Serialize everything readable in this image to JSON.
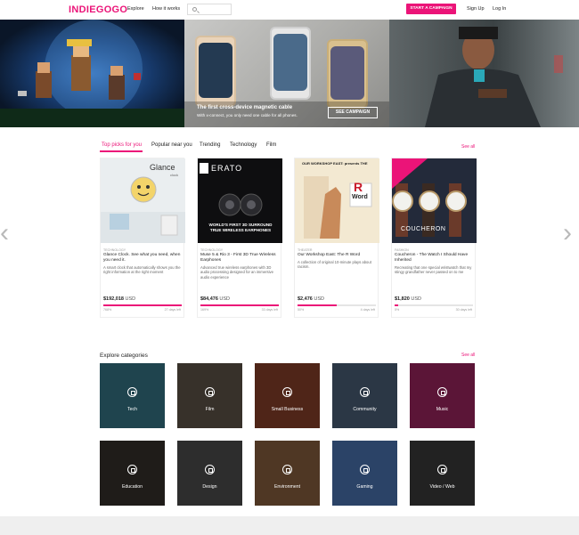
{
  "header": {
    "logo": "INDIEGOGO",
    "nav": [
      "Explore",
      "How it works"
    ],
    "cta": "START A CAMPAIGN",
    "sign_up": "Sign Up",
    "log_in": "Log In"
  },
  "hero": {
    "title": "The first cross-device magnetic cable",
    "subtitle": "With x-connect, you only need one cable for all phones.",
    "button": "SEE CAMPAIGN"
  },
  "tabs": [
    {
      "label": "Top picks for you",
      "active": true
    },
    {
      "label": "Popular near you",
      "active": false
    },
    {
      "label": "Trending",
      "active": false
    },
    {
      "label": "Technology",
      "active": false
    },
    {
      "label": "Film",
      "active": false
    }
  ],
  "see_all": "See all",
  "cards": [
    {
      "category": "TECHNOLOGY",
      "title": "Glance Clock. See what you need, when you need it.",
      "description": "A smart clock that automatically shows you the right information at the right moment",
      "raised": "$192,018",
      "currency": "USD",
      "percent_label": "768%",
      "percent": 100,
      "days": "27 days left"
    },
    {
      "category": "TECHNOLOGY",
      "title": "Muse 5 & Rio 3 - First 3D True Wireless Earphones",
      "description": "Advanced true wireless earphones with 3D audio processing designed for an immersive audio experience",
      "raised": "$84,476",
      "currency": "USD",
      "percent_label": "169%",
      "percent": 100,
      "days": "33 days left"
    },
    {
      "category": "THEATER",
      "title": "Our Workshop East: The R Word",
      "description": "A collection of original 10-minute plays about racism.",
      "raised": "$2,476",
      "currency": "USD",
      "percent_label": "50%",
      "percent": 50,
      "days": "4 days left"
    },
    {
      "category": "FASHION",
      "title": "Coucheron - The Watch I Should Have Inherited",
      "description": "Recreating that one special wristwatch that my stingy grandfather never passed on to me",
      "raised": "$1,820",
      "currency": "USD",
      "percent_label": "5%",
      "percent": 5,
      "days": "30 days left"
    }
  ],
  "card_images": {
    "glance": "Glance",
    "glance_sub": "clock",
    "erato": "ERATO",
    "erato_tag": "WORLD'S FIRST 3D SURROUND TRUE WIRELESS EARPHONES",
    "workshop_head": "OUR WORKSHOP EAST: presents THE",
    "workshop_word": "R",
    "workshop_word2": "Word",
    "coucheron": "COUCHERON"
  },
  "categories_title": "Explore categories",
  "categories": [
    {
      "label": "Tech",
      "color": "#2a5b68"
    },
    {
      "label": "Film",
      "color": "#4a4238"
    },
    {
      "label": "Small Business",
      "color": "#6a3220"
    },
    {
      "label": "Community",
      "color": "#3a4a5c"
    },
    {
      "label": "Music",
      "color": "#7a1c4a"
    },
    {
      "label": "Education",
      "color": "#2a2622"
    },
    {
      "label": "Design",
      "color": "#3c3c3c"
    },
    {
      "label": "Environment",
      "color": "#6a4a30"
    },
    {
      "label": "Gaming",
      "color": "#3a5a8a"
    },
    {
      "label": "Video / Web",
      "color": "#2e2e2e"
    }
  ],
  "colors": {
    "brand": "#eb1478"
  }
}
